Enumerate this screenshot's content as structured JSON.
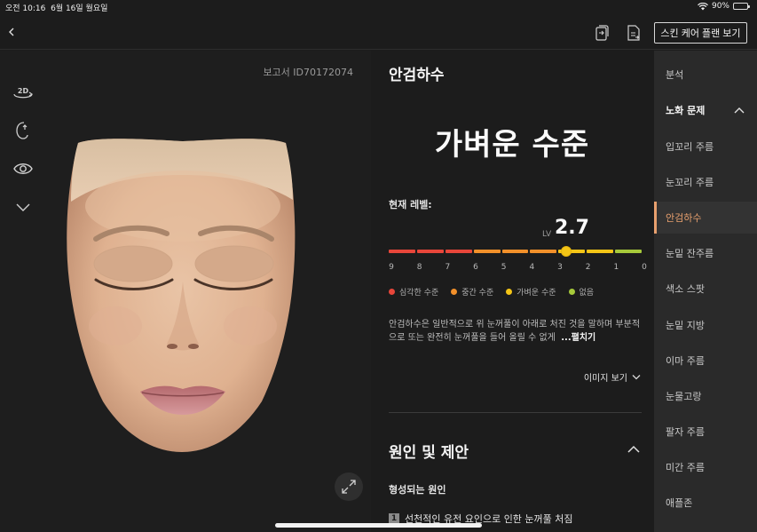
{
  "status_bar": {
    "time": "오전 10:16",
    "date": "6월 16일 월요일",
    "battery": "90%",
    "battery_level": 0.9
  },
  "topnav": {
    "plan_button": "스킨 케어 플랜 보기"
  },
  "left_panel": {
    "report_id": "보고서 ID70172074"
  },
  "main": {
    "title": "안검하수",
    "level_text": "가벼운 수준",
    "current_level_label": "현재 레벨:",
    "lv_label": "LV",
    "level_value": "2.7",
    "level_number": 2.7,
    "scale_ticks": [
      "9",
      "8",
      "7",
      "6",
      "5",
      "4",
      "3",
      "2",
      "1",
      "0"
    ],
    "legend": [
      {
        "label": "심각한 수준",
        "color": "#e8463a"
      },
      {
        "label": "중간 수준",
        "color": "#f2902a"
      },
      {
        "label": "가벼운 수준",
        "color": "#f4c516"
      },
      {
        "label": "없음",
        "color": "#a6c93a"
      }
    ],
    "description": "안검하수은 일반적으로 위 눈꺼풀이 아래로 처진 것을 말하며 부분적으로 또는 완전히 눈꺼풀을 들어 올릴 수 없게",
    "more_link": "...펼치기",
    "image_view": "이미지 보기",
    "cause_title": "원인 및 제안",
    "cause_subtitle": "형성되는 원인",
    "cause_item_num": "1",
    "cause_item_text": "선천적인 유전 요인으로 인한 눈꺼풀 처짐"
  },
  "sidebar": {
    "items": [
      {
        "label": "분석"
      },
      {
        "label": "노화 문제"
      },
      {
        "label": "입꼬리 주름"
      },
      {
        "label": "눈꼬리 주름"
      },
      {
        "label": "안검하수"
      },
      {
        "label": "눈밑 잔주름"
      },
      {
        "label": "색소 스팟"
      },
      {
        "label": "눈밑 지방"
      },
      {
        "label": "이마 주름"
      },
      {
        "label": "눈물고랑"
      },
      {
        "label": "팔자 주름"
      },
      {
        "label": "미간 주름"
      },
      {
        "label": "애플존"
      }
    ]
  },
  "colors": {
    "accent": "#e8a06e",
    "background": "#1c1c1c",
    "sidebar": "#2a2a2a"
  }
}
